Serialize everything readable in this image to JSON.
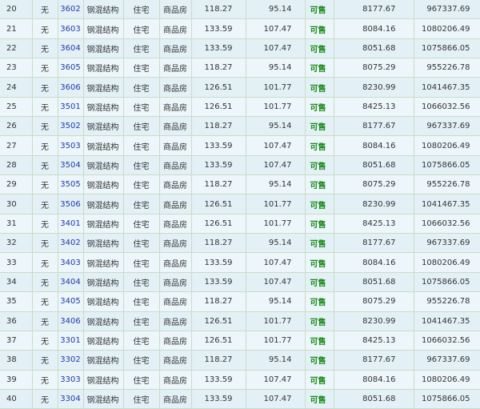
{
  "rows": [
    {
      "idx": "20",
      "deco": "无",
      "room": "3602",
      "structure": "钢混结构",
      "use": "住宅",
      "house_type": "商品房",
      "build_area": "118.27",
      "inner_area": "95.14",
      "status": "可售",
      "unit_price": "8177.67",
      "total": "967337.69"
    },
    {
      "idx": "21",
      "deco": "无",
      "room": "3603",
      "structure": "钢混结构",
      "use": "住宅",
      "house_type": "商品房",
      "build_area": "133.59",
      "inner_area": "107.47",
      "status": "可售",
      "unit_price": "8084.16",
      "total": "1080206.49"
    },
    {
      "idx": "22",
      "deco": "无",
      "room": "3604",
      "structure": "钢混结构",
      "use": "住宅",
      "house_type": "商品房",
      "build_area": "133.59",
      "inner_area": "107.47",
      "status": "可售",
      "unit_price": "8051.68",
      "total": "1075866.05"
    },
    {
      "idx": "23",
      "deco": "无",
      "room": "3605",
      "structure": "钢混结构",
      "use": "住宅",
      "house_type": "商品房",
      "build_area": "118.27",
      "inner_area": "95.14",
      "status": "可售",
      "unit_price": "8075.29",
      "total": "955226.78"
    },
    {
      "idx": "24",
      "deco": "无",
      "room": "3606",
      "structure": "钢混结构",
      "use": "住宅",
      "house_type": "商品房",
      "build_area": "126.51",
      "inner_area": "101.77",
      "status": "可售",
      "unit_price": "8230.99",
      "total": "1041467.35"
    },
    {
      "idx": "25",
      "deco": "无",
      "room": "3501",
      "structure": "钢混结构",
      "use": "住宅",
      "house_type": "商品房",
      "build_area": "126.51",
      "inner_area": "101.77",
      "status": "可售",
      "unit_price": "8425.13",
      "total": "1066032.56"
    },
    {
      "idx": "26",
      "deco": "无",
      "room": "3502",
      "structure": "钢混结构",
      "use": "住宅",
      "house_type": "商品房",
      "build_area": "118.27",
      "inner_area": "95.14",
      "status": "可售",
      "unit_price": "8177.67",
      "total": "967337.69"
    },
    {
      "idx": "27",
      "deco": "无",
      "room": "3503",
      "structure": "钢混结构",
      "use": "住宅",
      "house_type": "商品房",
      "build_area": "133.59",
      "inner_area": "107.47",
      "status": "可售",
      "unit_price": "8084.16",
      "total": "1080206.49"
    },
    {
      "idx": "28",
      "deco": "无",
      "room": "3504",
      "structure": "钢混结构",
      "use": "住宅",
      "house_type": "商品房",
      "build_area": "133.59",
      "inner_area": "107.47",
      "status": "可售",
      "unit_price": "8051.68",
      "total": "1075866.05"
    },
    {
      "idx": "29",
      "deco": "无",
      "room": "3505",
      "structure": "钢混结构",
      "use": "住宅",
      "house_type": "商品房",
      "build_area": "118.27",
      "inner_area": "95.14",
      "status": "可售",
      "unit_price": "8075.29",
      "total": "955226.78"
    },
    {
      "idx": "30",
      "deco": "无",
      "room": "3506",
      "structure": "钢混结构",
      "use": "住宅",
      "house_type": "商品房",
      "build_area": "126.51",
      "inner_area": "101.77",
      "status": "可售",
      "unit_price": "8230.99",
      "total": "1041467.35"
    },
    {
      "idx": "31",
      "deco": "无",
      "room": "3401",
      "structure": "钢混结构",
      "use": "住宅",
      "house_type": "商品房",
      "build_area": "126.51",
      "inner_area": "101.77",
      "status": "可售",
      "unit_price": "8425.13",
      "total": "1066032.56"
    },
    {
      "idx": "32",
      "deco": "无",
      "room": "3402",
      "structure": "钢混结构",
      "use": "住宅",
      "house_type": "商品房",
      "build_area": "118.27",
      "inner_area": "95.14",
      "status": "可售",
      "unit_price": "8177.67",
      "total": "967337.69"
    },
    {
      "idx": "33",
      "deco": "无",
      "room": "3403",
      "structure": "钢混结构",
      "use": "住宅",
      "house_type": "商品房",
      "build_area": "133.59",
      "inner_area": "107.47",
      "status": "可售",
      "unit_price": "8084.16",
      "total": "1080206.49"
    },
    {
      "idx": "34",
      "deco": "无",
      "room": "3404",
      "structure": "钢混结构",
      "use": "住宅",
      "house_type": "商品房",
      "build_area": "133.59",
      "inner_area": "107.47",
      "status": "可售",
      "unit_price": "8051.68",
      "total": "1075866.05"
    },
    {
      "idx": "35",
      "deco": "无",
      "room": "3405",
      "structure": "钢混结构",
      "use": "住宅",
      "house_type": "商品房",
      "build_area": "118.27",
      "inner_area": "95.14",
      "status": "可售",
      "unit_price": "8075.29",
      "total": "955226.78"
    },
    {
      "idx": "36",
      "deco": "无",
      "room": "3406",
      "structure": "钢混结构",
      "use": "住宅",
      "house_type": "商品房",
      "build_area": "126.51",
      "inner_area": "101.77",
      "status": "可售",
      "unit_price": "8230.99",
      "total": "1041467.35"
    },
    {
      "idx": "37",
      "deco": "无",
      "room": "3301",
      "structure": "钢混结构",
      "use": "住宅",
      "house_type": "商品房",
      "build_area": "126.51",
      "inner_area": "101.77",
      "status": "可售",
      "unit_price": "8425.13",
      "total": "1066032.56"
    },
    {
      "idx": "38",
      "deco": "无",
      "room": "3302",
      "structure": "钢混结构",
      "use": "住宅",
      "house_type": "商品房",
      "build_area": "118.27",
      "inner_area": "95.14",
      "status": "可售",
      "unit_price": "8177.67",
      "total": "967337.69"
    },
    {
      "idx": "39",
      "deco": "无",
      "room": "3303",
      "structure": "钢混结构",
      "use": "住宅",
      "house_type": "商品房",
      "build_area": "133.59",
      "inner_area": "107.47",
      "status": "可售",
      "unit_price": "8084.16",
      "total": "1080206.49"
    },
    {
      "idx": "40",
      "deco": "无",
      "room": "3304",
      "structure": "钢混结构",
      "use": "住宅",
      "house_type": "商品房",
      "build_area": "133.59",
      "inner_area": "107.47",
      "status": "可售",
      "unit_price": "8051.68",
      "total": "1075866.05"
    }
  ]
}
